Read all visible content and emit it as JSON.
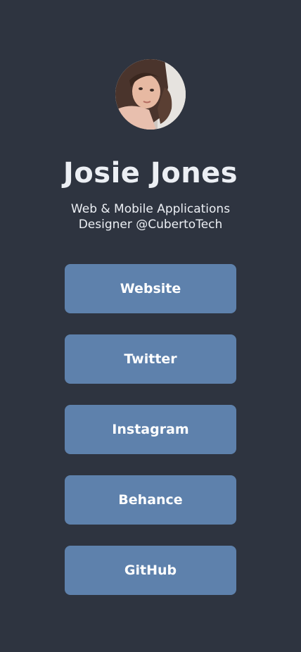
{
  "profile": {
    "name": "Josie Jones",
    "bio": "Web & Mobile Applications Designer @CubertoTech",
    "avatar_icon": "profile-photo"
  },
  "links": [
    {
      "label": "Website"
    },
    {
      "label": "Twitter"
    },
    {
      "label": "Instagram"
    },
    {
      "label": "Behance"
    },
    {
      "label": "GitHub"
    }
  ],
  "colors": {
    "background": "#2e3440",
    "button": "#5e81ac",
    "text": "#eceff4"
  }
}
